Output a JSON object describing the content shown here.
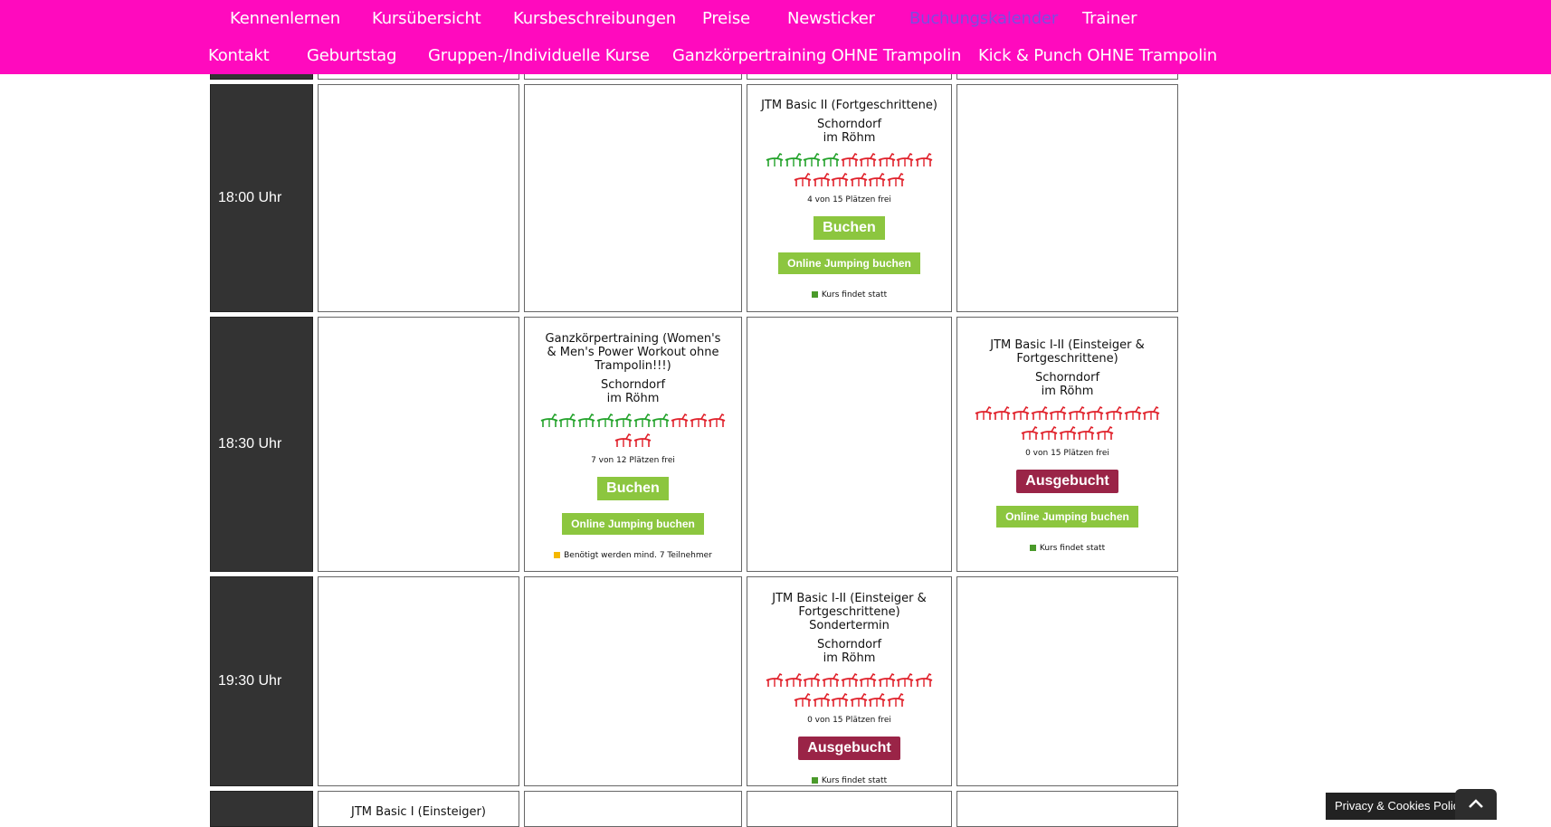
{
  "nav": {
    "row1": [
      "Kennenlernen",
      "Kursübersicht",
      "Kursbeschreibungen",
      "Preise",
      "Newsticker",
      "Buchungskalender",
      "Trainer"
    ],
    "row2": [
      "Kontakt",
      "Geburtstag",
      "Gruppen-/Individuelle Kurse",
      "Ganzkörpertraining OHNE Trampolin",
      "Kick & Punch OHNE Trampolin"
    ],
    "active": "Buchungskalender"
  },
  "colors": {
    "nav_bg": "#ff0abe",
    "seat_free": "#22a22a",
    "seat_taken": "#e0202a",
    "book": "#8cc63f",
    "sold_out": "#9a2447"
  },
  "times": [
    "18:00 Uhr",
    "18:30 Uhr",
    "19:30 Uhr"
  ],
  "courses": {
    "c1800": {
      "title": "JTM Basic II (Fortgeschrittene)",
      "location": "Schorndorf",
      "venue": "im Röhm",
      "seats_total": 15,
      "seats_free": 4,
      "free_text": "4 von 15 Plätzen frei",
      "book_label": "Buchen",
      "online_label": "Online Jumping buchen",
      "status_text": "Kurs findet statt",
      "status_color": "#4a9a2a"
    },
    "c1830a": {
      "title": "Ganzkörpertraining (Women's & Men's Power Workout ohne Trampolin!!!)",
      "location": "Schorndorf",
      "venue": "im Röhm",
      "seats_total": 12,
      "seats_free": 7,
      "free_text": "7 von 12 Plätzen frei",
      "book_label": "Buchen",
      "online_label": "Online Jumping buchen",
      "status_text": "Benötigt werden mind. 7 Teilnehmer",
      "status_color": "#f5b800"
    },
    "c1830b": {
      "title": "JTM Basic I-II (Einsteiger & Fortgeschrittene)",
      "location": "Schorndorf",
      "venue": "im Röhm",
      "seats_total": 15,
      "seats_free": 0,
      "free_text": "0 von 15 Plätzen frei",
      "sold_label": "Ausgebucht",
      "online_label": "Online Jumping buchen",
      "status_text": "Kurs findet statt",
      "status_color": "#4a9a2a"
    },
    "c1930": {
      "title": "JTM Basic I-II (Einsteiger & Fortgeschrittene) Sondertermin",
      "location": "Schorndorf",
      "venue": "im Röhm",
      "seats_total": 15,
      "seats_free": 0,
      "free_text": "0 von 15 Plätzen frei",
      "sold_label": "Ausgebucht",
      "status_text": "Kurs findet statt",
      "status_color": "#4a9a2a"
    },
    "cnext": {
      "title": "JTM Basic I (Einsteiger)"
    }
  },
  "privacy": {
    "label": "Privacy & Cookies Policy"
  }
}
